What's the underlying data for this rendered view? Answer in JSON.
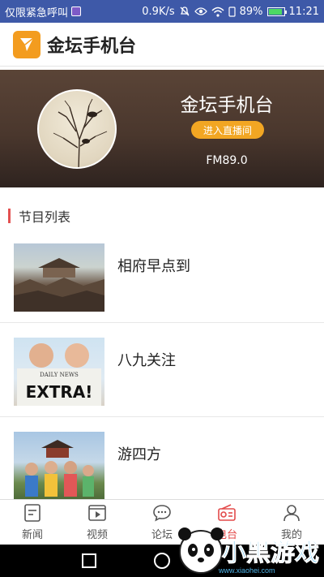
{
  "status_bar": {
    "left_text": "仅限紧急呼叫",
    "net_speed": "0.9K/s",
    "battery_percent": "89%",
    "battery_level": 0.89,
    "time": "11:21",
    "icons": [
      "sim-icon",
      "mute-icon",
      "eye-icon",
      "wifi-icon",
      "phone-icon",
      "battery-icon"
    ]
  },
  "header": {
    "app_title": "金坛手机台",
    "logo_icon": "paper-plane-icon",
    "logo_color": "#f39c1f"
  },
  "banner": {
    "station_name": "金坛手机台",
    "live_button_label": "进入直播间",
    "frequency": "FM89.0",
    "photo": "birds-on-branches-illustration"
  },
  "section": {
    "title": "节目列表",
    "accent_color": "#e35050"
  },
  "programs": [
    {
      "name": "相府早点到",
      "thumb": "ancient-town-rooftops-photo"
    },
    {
      "name": "八九关注",
      "thumb": "newspaper-readers-photo",
      "thumb_text": [
        "DAILY NEWS",
        "EXTRA!"
      ]
    },
    {
      "name": "游四方",
      "thumb": "tourists-at-pavilion-photo"
    }
  ],
  "tabbar": {
    "active_color": "#e34a4a",
    "tabs": [
      {
        "label": "新闻",
        "icon": "news-icon",
        "active": false
      },
      {
        "label": "视频",
        "icon": "video-icon",
        "active": false
      },
      {
        "label": "论坛",
        "icon": "chat-icon",
        "active": false
      },
      {
        "label": "电台",
        "icon": "radio-icon",
        "active": true
      },
      {
        "label": "我的",
        "icon": "user-icon",
        "active": false
      }
    ]
  },
  "watermark": {
    "brand": "小黑游戏",
    "domain": "www.xiaohei.com"
  }
}
